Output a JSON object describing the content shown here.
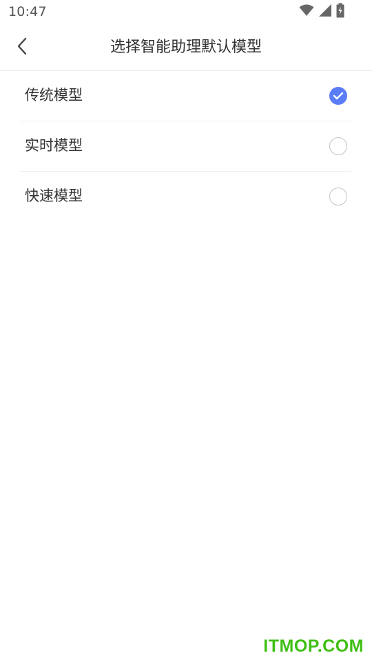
{
  "status_bar": {
    "time": "10:47",
    "icons": [
      "wifi-icon",
      "signal-icon",
      "battery-charging-icon"
    ]
  },
  "header": {
    "back_icon": "chevron-left-icon",
    "title": "选择智能助理默认模型"
  },
  "models": [
    {
      "label": "传统模型",
      "selected": true
    },
    {
      "label": "实时模型",
      "selected": false
    },
    {
      "label": "快速模型",
      "selected": false
    }
  ],
  "colors": {
    "accent": "#5b7cf7",
    "text": "#333333",
    "divider": "#eeeeee",
    "watermark": "#3fbf14"
  },
  "watermark": "ITMOP.COM"
}
